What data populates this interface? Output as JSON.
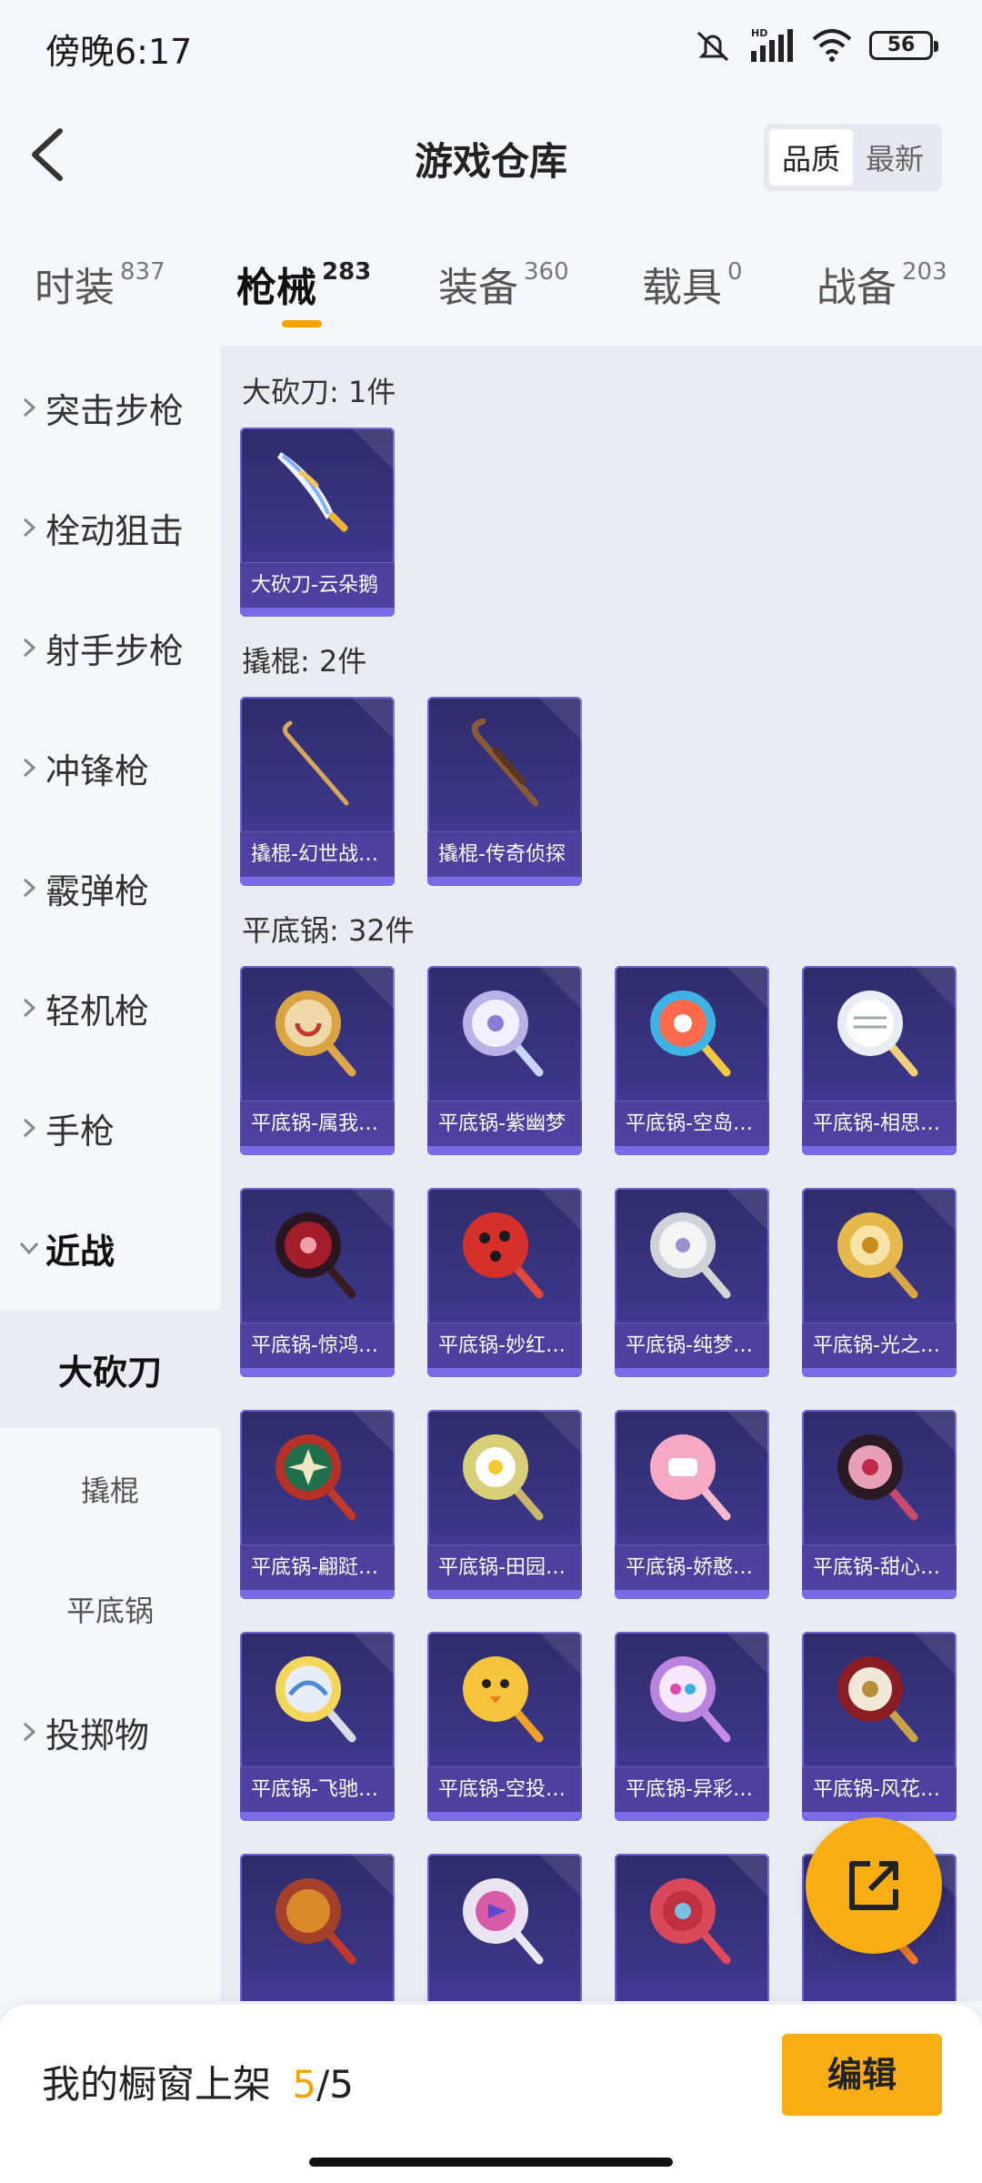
{
  "status": {
    "time": "傍晚6:17",
    "battery": "56",
    "network": "HD"
  },
  "header": {
    "title": "游戏仓库",
    "sort_quality": "品质",
    "sort_newest": "最新"
  },
  "tabs": [
    {
      "label": "时装",
      "count": "837"
    },
    {
      "label": "枪械",
      "count": "283"
    },
    {
      "label": "装备",
      "count": "360"
    },
    {
      "label": "载具",
      "count": "0"
    },
    {
      "label": "战备",
      "count": "203"
    }
  ],
  "active_tab": "枪械",
  "sidebar": {
    "categories": [
      "突击步枪",
      "栓动狙击",
      "射手步枪",
      "冲锋枪",
      "霰弹枪",
      "轻机枪",
      "手枪",
      "近战"
    ],
    "subitems": [
      "大砍刀",
      "撬棍",
      "平底锅"
    ],
    "last": "投掷物"
  },
  "sections": [
    {
      "title": "大砍刀: 1件"
    },
    {
      "title": "撬棍: 2件"
    },
    {
      "title": "平底锅: 32件"
    }
  ],
  "items": [
    "大砍刀-云朵鹅",
    "撬棍-幻世战…",
    "撬棍-传奇侦探",
    "平底锅-属我…",
    "平底锅-紫幽梦",
    "平底锅-空岛…",
    "平底锅-相思…",
    "平底锅-惊鸿…",
    "平底锅-妙红…",
    "平底锅-纯梦…",
    "平底锅-光之…",
    "平底锅-翩跹…",
    "平底锅-田园…",
    "平底锅-娇憨…",
    "平底锅-甜心…",
    "平底锅-飞驰…",
    "平底锅-空投…",
    "平底锅-异彩…",
    "平底锅-风花…"
  ],
  "bottom": {
    "showcase_label": "我的橱窗上架",
    "count_current": "5",
    "count_sep": "/5",
    "edit": "编辑"
  },
  "colors": {
    "accent": "#f7ad14",
    "card": "#3a3584"
  }
}
